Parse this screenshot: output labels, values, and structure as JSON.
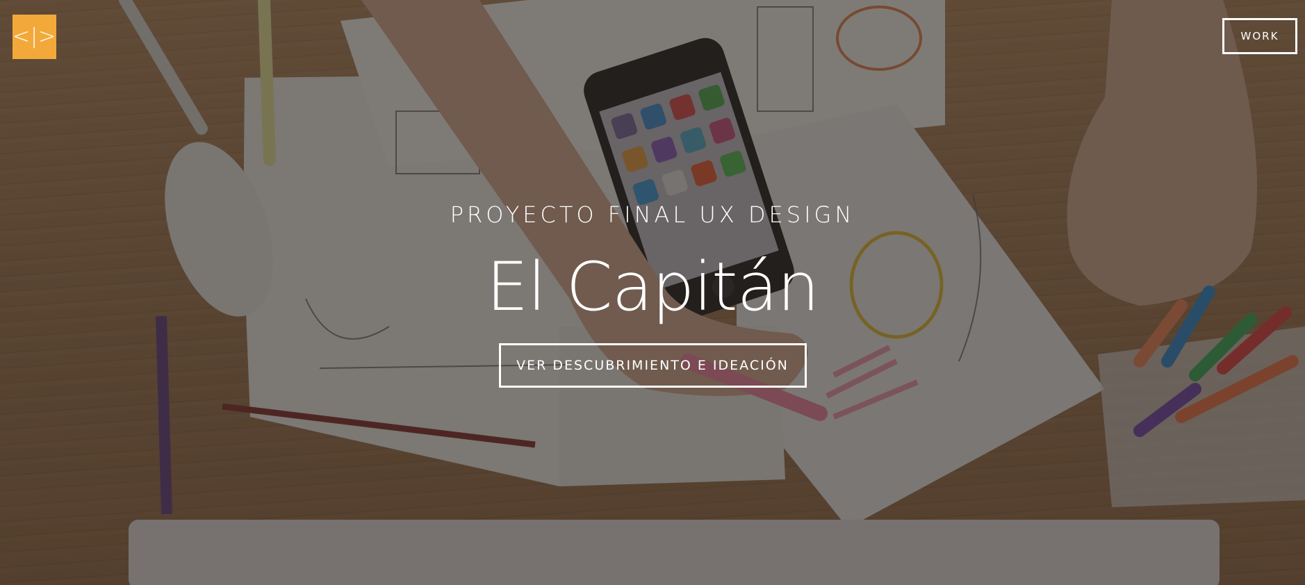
{
  "header": {
    "logo_glyph": "<|>",
    "work_label": "WORK"
  },
  "hero": {
    "eyebrow": "PROYECTO FINAL UX DESIGN",
    "title": "El Capitán",
    "cta_label": "VER DESCUBRIMIENTO E IDEACIÓN"
  },
  "colors": {
    "accent": "#f3a93a",
    "text": "#ffffff",
    "overlay": "rgba(28,22,18,0.55)"
  }
}
